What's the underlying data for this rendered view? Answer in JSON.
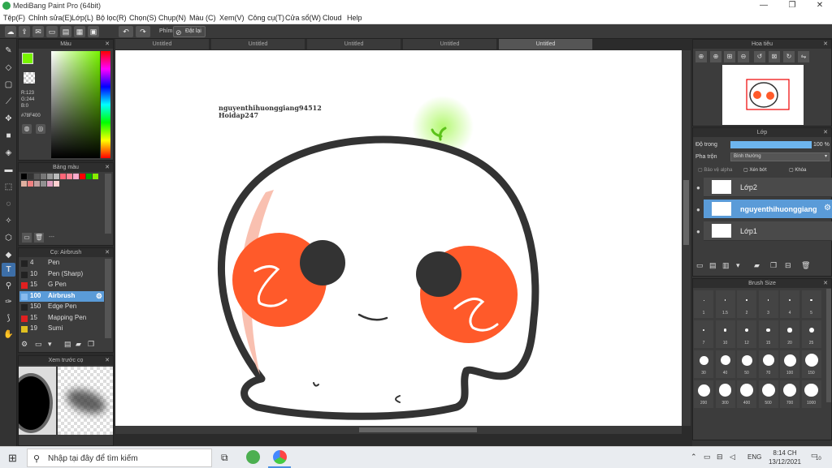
{
  "window": {
    "title": "MediBang Paint Pro (64bit)"
  },
  "menu": [
    "Tệp(F)",
    "Chỉnh sửa(E)",
    "Lớp(L)",
    "Bộ lọc(R)",
    "Chọn(S)",
    "Chụp(N)",
    "Màu (C)",
    "Xem(V)",
    "Công cụ(T)",
    "Cửa sổ(W)",
    "Cloud",
    "Help"
  ],
  "toolbar": {
    "key_label": "Phím",
    "reset_label": "Đặt lại"
  },
  "color_panel": {
    "title": "Màu",
    "r": "R:123",
    "g": "G:244",
    "b": "B:0",
    "hex": "#78F400",
    "fg": "#78f400",
    "bg": "#000000"
  },
  "palette_panel": {
    "title": "Bảng màu",
    "footer": "---",
    "swatches": [
      "#000000",
      "#333333",
      "#555555",
      "#777777",
      "#999999",
      "#bbbbbb",
      "#ff6677",
      "#ff8899",
      "#ffaacc",
      "#ff0000",
      "#00aa00",
      "#88ee00",
      "#e0b0a0",
      "#f08080",
      "#c0a0a0",
      "#909090",
      "#e0a0c0",
      "#ffd0d0"
    ]
  },
  "brush_panel": {
    "title": "Cọ: Airbrush",
    "items": [
      {
        "size": "4",
        "name": "Pen",
        "color": "#222222"
      },
      {
        "size": "10",
        "name": "Pen (Sharp)",
        "color": "#222222"
      },
      {
        "size": "15",
        "name": "G Pen",
        "color": "#e02020"
      },
      {
        "size": "100",
        "name": "Airbrush",
        "color": "#88bbee",
        "selected": true
      },
      {
        "size": "150",
        "name": "Edge Pen",
        "color": "#222222"
      },
      {
        "size": "15",
        "name": "Mapping Pen",
        "color": "#e02020"
      },
      {
        "size": "19",
        "name": "Sumi",
        "color": "#e0c020"
      }
    ]
  },
  "preview_panel": {
    "title": "Xem trước cọ"
  },
  "tabs": [
    "Untitled",
    "Untitled",
    "Untitled",
    "Untitled",
    "Untitled"
  ],
  "canvas": {
    "line1": "nguyenthihuonggiang94512",
    "line2": "Hoidap247"
  },
  "navigator": {
    "title": "Hoa tiêu"
  },
  "layers": {
    "title": "Lớp",
    "opacity_label": "Độ trong",
    "opacity_value": "100 %",
    "blend_label": "Pha trộn",
    "blend_value": "Bình thường",
    "protect_alpha": "Bảo vệ alpha",
    "clip": "Xén bớt",
    "lock": "Khóa",
    "items": [
      {
        "name": "Lớp2"
      },
      {
        "name": "nguyenthihuonggiang",
        "selected": true
      },
      {
        "name": "Lớp1"
      }
    ]
  },
  "brush_size": {
    "title": "Brush Size",
    "sizes": [
      "1",
      "1.5",
      "2",
      "3",
      "4",
      "5",
      "7",
      "10",
      "12",
      "15",
      "20",
      "25",
      "30",
      "40",
      "50",
      "70",
      "100",
      "150",
      "200",
      "300",
      "400",
      "500",
      "700",
      "1000"
    ]
  },
  "taskbar": {
    "search_placeholder": "Nhập tại đây để tìm kiếm",
    "lang": "ENG",
    "time": "8:14 CH",
    "date": "13/12/2021",
    "notif": "10"
  }
}
